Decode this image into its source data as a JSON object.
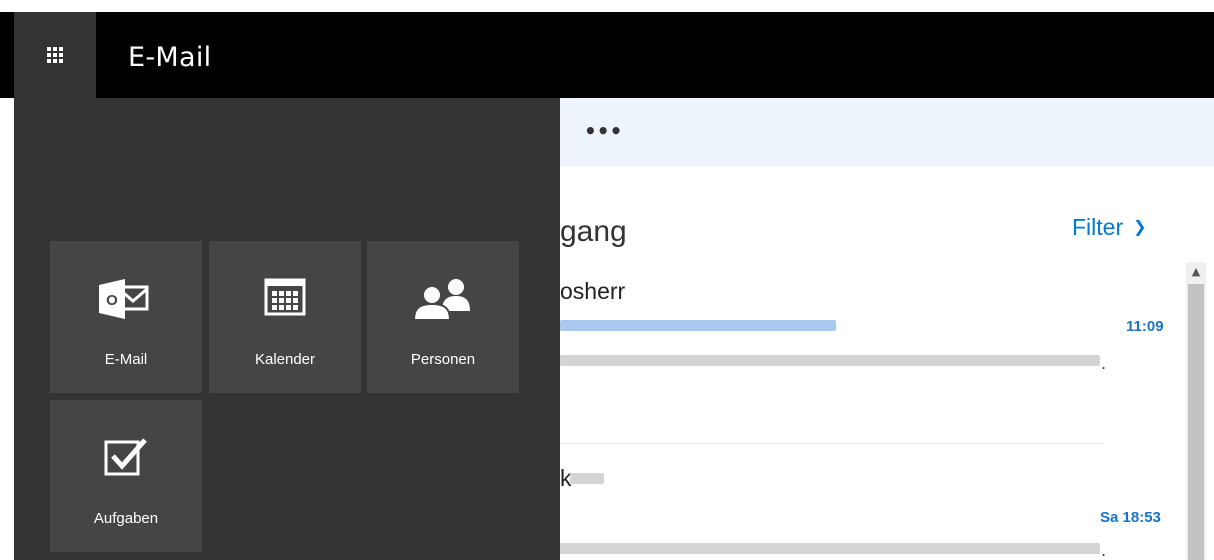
{
  "header": {
    "app_title": "E-Mail",
    "launcher_icon": "waffle-icon"
  },
  "launcher": {
    "tiles": [
      {
        "label": "E-Mail",
        "icon": "outlook-mail-icon"
      },
      {
        "label": "Kalender",
        "icon": "calendar-icon"
      },
      {
        "label": "Personen",
        "icon": "people-icon"
      },
      {
        "label": "Aufgaben",
        "icon": "tasks-checkbox-icon"
      }
    ]
  },
  "toolbar": {
    "more_label": "•••"
  },
  "message_list": {
    "folder_title": "gang",
    "filter_label": "Filter",
    "messages": [
      {
        "sender": "osherr",
        "time": "11:09"
      },
      {
        "sender": "k",
        "time": "Sa 18:53"
      }
    ]
  },
  "colors": {
    "topbar": "#000000",
    "drawer": "#333333",
    "tile": "#454545",
    "accent": "#0078d7",
    "toolbar": "#eef4fb"
  }
}
